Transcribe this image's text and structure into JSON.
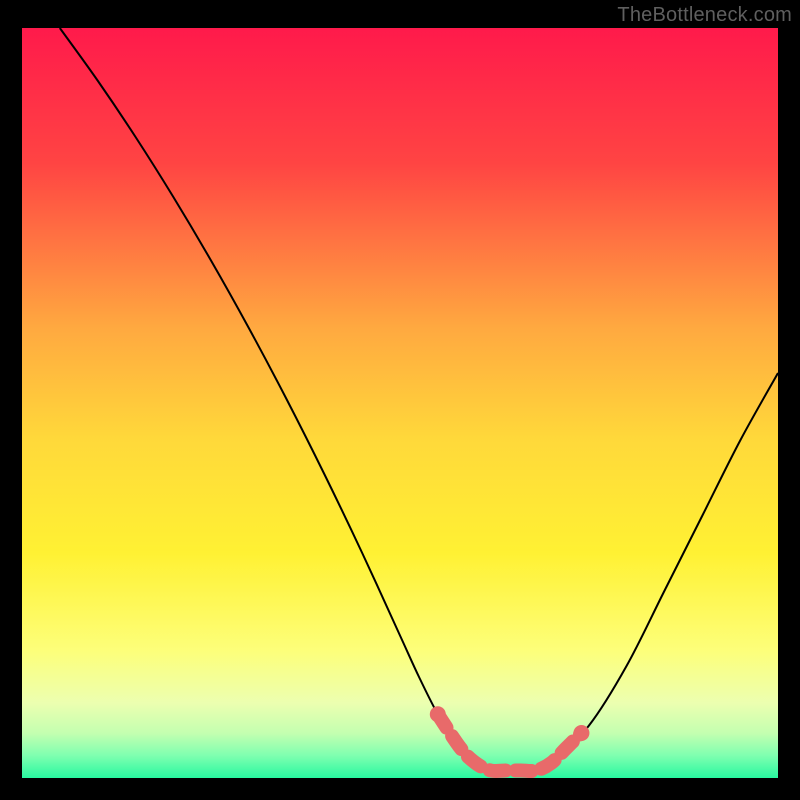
{
  "watermark": {
    "text": "TheBottleneck.com"
  },
  "colors": {
    "stroke": "#000000",
    "marker": "#e86a6a",
    "frame_bg": "#000000"
  },
  "chart_data": {
    "type": "line",
    "title": "",
    "xlabel": "",
    "ylabel": "",
    "xlim": [
      0,
      100
    ],
    "ylim": [
      0,
      100
    ],
    "series": [
      {
        "name": "curve",
        "x": [
          5,
          10,
          15,
          20,
          25,
          30,
          35,
          40,
          45,
          50,
          52.5,
          55,
          57.5,
          60,
          62.5,
          65,
          67.5,
          70,
          75,
          80,
          85,
          90,
          95,
          100
        ],
        "y": [
          100,
          93,
          85.5,
          77.5,
          69,
          60,
          50.5,
          40.5,
          30,
          19,
          13.5,
          8.5,
          4.5,
          2,
          1,
          1,
          1,
          2,
          7,
          15,
          25,
          35,
          45,
          54
        ]
      }
    ],
    "markers": {
      "name": "sweet-spot",
      "x": [
        55,
        58,
        60,
        62,
        64,
        66,
        68,
        70,
        72,
        74
      ],
      "y": [
        8.5,
        4,
        2,
        1,
        1,
        1,
        1,
        2,
        4,
        6
      ]
    },
    "gradient_stops": [
      {
        "offset": 0.0,
        "color": "#ff1a4b"
      },
      {
        "offset": 0.18,
        "color": "#ff4443"
      },
      {
        "offset": 0.4,
        "color": "#ffa940"
      },
      {
        "offset": 0.55,
        "color": "#ffd93a"
      },
      {
        "offset": 0.7,
        "color": "#fff133"
      },
      {
        "offset": 0.83,
        "color": "#fdff7a"
      },
      {
        "offset": 0.9,
        "color": "#ecffb0"
      },
      {
        "offset": 0.94,
        "color": "#c4ffb0"
      },
      {
        "offset": 0.97,
        "color": "#7fffb0"
      },
      {
        "offset": 1.0,
        "color": "#28f8a0"
      }
    ]
  }
}
